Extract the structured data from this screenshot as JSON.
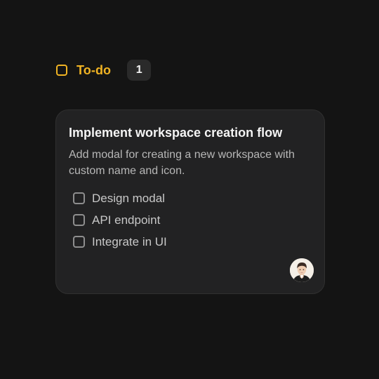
{
  "column": {
    "title": "To-do",
    "count": "1",
    "accent_color": "#f0b323",
    "icon": "status-square-icon"
  },
  "card": {
    "title": "Implement workspace creation flow",
    "description": "Add modal for creating a new workspace with custom name and icon.",
    "subtasks": [
      {
        "label": "Design modal",
        "checked": false
      },
      {
        "label": "API endpoint",
        "checked": false
      },
      {
        "label": "Integrate in UI",
        "checked": false
      }
    ],
    "assignee": {
      "icon": "avatar-icon"
    }
  }
}
